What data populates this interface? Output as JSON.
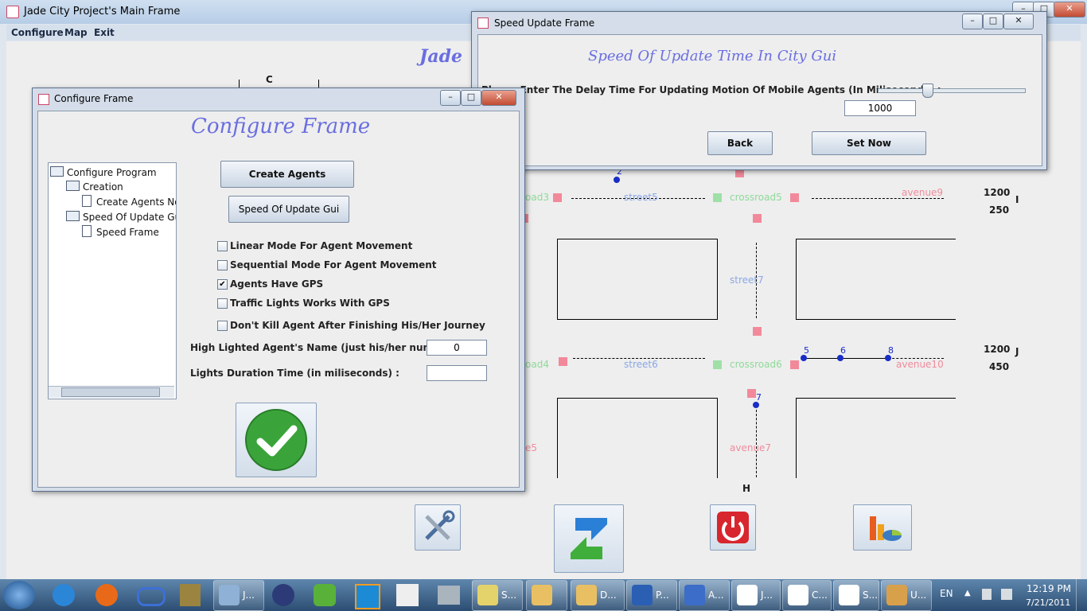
{
  "main_window": {
    "title": "Jade City Project's Main Frame",
    "heading": "Jade",
    "menu": [
      "Configure",
      "Map",
      "Exit"
    ]
  },
  "map": {
    "column_labels": {
      "c": "C",
      "h": "H",
      "i": "I",
      "j": "J"
    },
    "streets": {
      "street5": "street5",
      "street6": "street6",
      "street7": "street7"
    },
    "crossroads": {
      "crossroad5": "crossroad5",
      "crossroad6": "crossroad6",
      "road3": "oad3",
      "road4": "oad4"
    },
    "avenues": {
      "avenue9": "avenue9",
      "avenue10": "avenue10",
      "avenue7": "avenue7",
      "cut": "e5"
    },
    "coords": {
      "i_x": "1200",
      "i_y": "250",
      "j_x": "1200",
      "j_y": "450"
    },
    "agents": [
      "2",
      "5",
      "6",
      "8",
      "7"
    ]
  },
  "speed_frame": {
    "title": "Speed Update Frame",
    "heading": "Speed Of Update Time In City Gui",
    "prompt": "Please Enter The Delay Time For Updating Motion Of Mobile Agents (In Miliseconds) :",
    "slider_level": 0.33,
    "value": "1000",
    "back_label": "Back",
    "set_label": "Set Now"
  },
  "configure_frame": {
    "title": "Configure Frame",
    "heading": "Configure Frame",
    "tree": {
      "root": "Configure Program",
      "creation": "Creation",
      "create_now": "Create Agents Now",
      "speed": "Speed Of Update Gui",
      "speed_frame": "Speed Frame"
    },
    "create_agents_label": "Create Agents",
    "speed_update_label": "Speed Of Update Gui",
    "options": [
      {
        "label": "Linear Mode For Agent Movement",
        "checked": false
      },
      {
        "label": "Sequential Mode For Agent Movement",
        "checked": false
      },
      {
        "label": "Agents Have GPS",
        "checked": true
      },
      {
        "label": "Traffic Lights Works With GPS",
        "checked": false
      },
      {
        "label": "Don't Kill Agent After Finishing His/Her Journey",
        "checked": false
      }
    ],
    "highlight_label": "High Lighted Agent's Name (just his/her number) :",
    "highlight_value": "0",
    "lights_label": "Lights Duration Time (in miliseconds) :",
    "lights_value": ""
  },
  "taskbar": {
    "apps": [
      "J...",
      "S...",
      "D...",
      "P...",
      "A...",
      "J...",
      "C...",
      "S...",
      "U..."
    ],
    "lang": "EN",
    "time": "12:19 PM",
    "date": "7/21/2011"
  },
  "colors": {
    "heading": "#6a6ee0",
    "street": "#8aa7e6",
    "crossroad": "#8fd99a",
    "avenue": "#f08b9c",
    "agent": "#1a2dc8"
  }
}
